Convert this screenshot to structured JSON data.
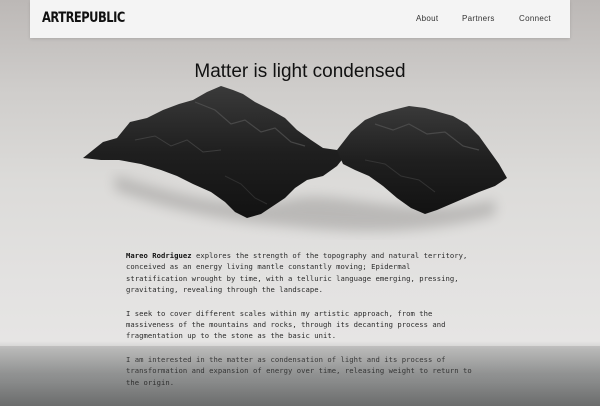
{
  "nav": {
    "logo": "ARTREPUBLIC",
    "links": [
      "About",
      "Partners",
      "Connect"
    ]
  },
  "hero": {
    "title": "Matter is light condensed"
  },
  "content": {
    "artist_name": "Mareo Rodriguez",
    "p1_rest": " explores the strength of the topography and natural territory, conceived as an energy living mantle constantly moving; Epidermal stratification wrought by time, with a telluric language emerging, pressing, gravitating, revealing through the landscape.",
    "p2": "I seek to cover different scales within my artistic approach, from the massiveness of the mountains and rocks, through its decanting process and fragmentation up to the stone as the basic unit.",
    "p3": "I am interested in the matter as condensation of light and its process of transformation and expansion of energy over time, releasing weight to return to the origin."
  },
  "colors": {
    "rock": "#1e1e1e",
    "rock_highlight": "#4a4a4a",
    "text": "#2a2a2a"
  }
}
